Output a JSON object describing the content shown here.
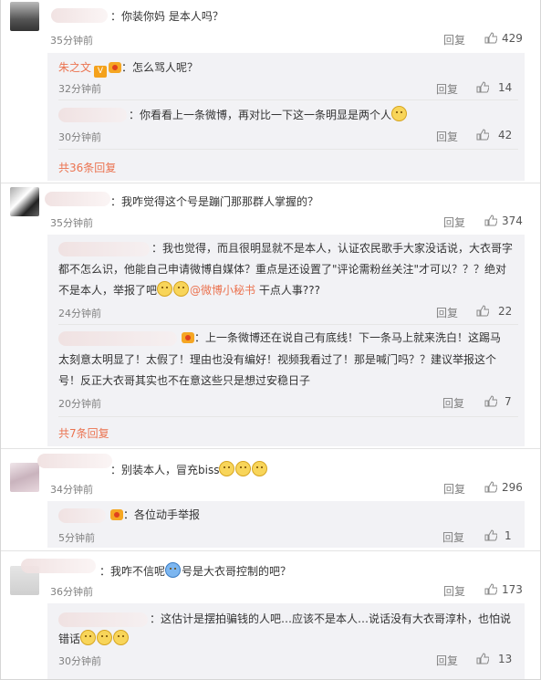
{
  "comments": [
    {
      "text": "：你装你妈 是本人吗？",
      "time": "35分钟前",
      "reply": "回复",
      "likes": "429",
      "subs": [
        {
          "name": "朱之文",
          "text": "：怎么骂人呢？",
          "time": "32分钟前",
          "reply": "回复",
          "likes": "14"
        },
        {
          "text": "：你看看上一条微博，再对比一下这一条明显是两个人",
          "time": "30分钟前",
          "reply": "回复",
          "likes": "42"
        }
      ],
      "more": "共36条回复"
    },
    {
      "text": "：我咋觉得这个号是蹦门那那群人掌握的？",
      "time": "35分钟前",
      "reply": "回复",
      "likes": "374",
      "subs": [
        {
          "line1": "：我也觉得，而且很明显就不是本人，认证农民歌手大家没话说，大衣哥字",
          "line2": "都不怎么识，他能自己申请微博自媒体？重点是还设置了\"评论需粉丝关注\"才可以？？？绝对",
          "line3a": "不是本人，举报了吧",
          "mention": "@微博小秘书",
          "line3b": " 干点人事???",
          "time": "24分钟前",
          "reply": "回复",
          "likes": "22"
        },
        {
          "line1": "：上一条微博还在说自己有底线！下一条马上就来洗白！这踢马",
          "line2": "太刻意太明显了！太假了！理由也没有编好！视频我看过了！那是喊门吗？？建议举报这个",
          "line3": "号！反正大衣哥其实也不在意这些只是想过安稳日子",
          "time": "20分钟前",
          "reply": "回复",
          "likes": "7"
        }
      ],
      "more": "共7条回复"
    },
    {
      "text": "：别装本人，冒充biss",
      "time": "34分钟前",
      "reply": "回复",
      "likes": "296",
      "subs": [
        {
          "text": "：各位动手举报",
          "time": "5分钟前",
          "reply": "回复",
          "likes": "1"
        }
      ]
    },
    {
      "text": "：我咋不信呢",
      "text2": "号是大衣哥控制的吧？",
      "time": "36分钟前",
      "reply": "回复",
      "likes": "173",
      "subs": [
        {
          "line1": "：这估计是摆拍骗钱的人吧…应该不是本人…说话没有大衣哥淳朴，也怕说",
          "line2": "错话",
          "time": "30分钟前",
          "reply": "回复",
          "likes": "13"
        }
      ]
    }
  ],
  "icons": {
    "like": "thumbs-up-icon",
    "emoji": "smiley-emoji",
    "vip": "vip-badge-icon",
    "crown": "member-crown-icon"
  },
  "colors": {
    "name": "#eb7350",
    "meta": "#808080",
    "sub_bg": "#f2f2f5"
  }
}
